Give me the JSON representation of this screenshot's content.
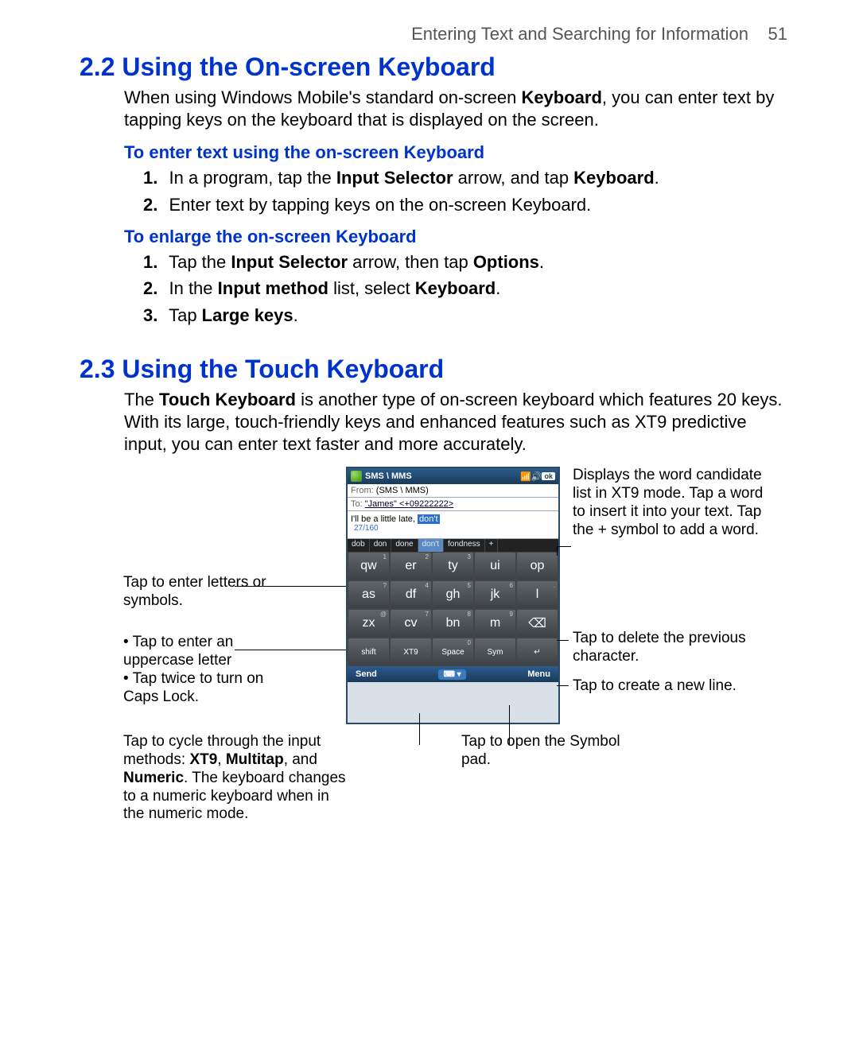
{
  "header": {
    "chapter_title": "Entering Text and Searching for Information",
    "page_number": "51"
  },
  "section22": {
    "heading": "2.2  Using the On-screen Keyboard",
    "intro_pre": "When using Windows Mobile's standard on-screen ",
    "intro_bold": "Keyboard",
    "intro_post": ", you can enter text by tapping keys on the keyboard that is displayed on the screen.",
    "sub1": "To enter text using the on-screen Keyboard",
    "s1_1_num": "1.",
    "s1_1_a": "In a program, tap the ",
    "s1_1_b": "Input Selector",
    "s1_1_c": " arrow, and tap ",
    "s1_1_d": "Keyboard",
    "s1_1_e": ".",
    "s1_2_num": "2.",
    "s1_2": "Enter text by tapping keys on the on-screen Keyboard.",
    "sub2": "To enlarge the on-screen Keyboard",
    "s2_1_num": "1.",
    "s2_1_a": "Tap the ",
    "s2_1_b": "Input Selector",
    "s2_1_c": " arrow, then tap ",
    "s2_1_d": "Options",
    "s2_1_e": ".",
    "s2_2_num": "2.",
    "s2_2_a": "In the ",
    "s2_2_b": "Input method",
    "s2_2_c": " list, select ",
    "s2_2_d": "Keyboard",
    "s2_2_e": ".",
    "s2_3_num": "3.",
    "s2_3_a": "Tap ",
    "s2_3_b": "Large keys",
    "s2_3_c": "."
  },
  "section23": {
    "heading": "2.3  Using the Touch Keyboard",
    "intro_a": "The ",
    "intro_b": "Touch Keyboard",
    "intro_c": " is another type of on-screen keyboard which features 20 keys. With its large, touch-friendly keys and enhanced features such as XT9 predictive input, you can enter text faster and more accurately."
  },
  "callouts": {
    "letters": "Tap to enter letters or symbols.",
    "upper1": "Tap to enter an uppercase letter",
    "upper2": "Tap twice to turn on Caps Lock.",
    "cycle_a": "Tap to cycle through the input methods: ",
    "cycle_b1": "XT9",
    "cycle_sep1": ", ",
    "cycle_b2": "Multitap",
    "cycle_sep2": ", and ",
    "cycle_b3": "Numeric",
    "cycle_c": ". The keyboard changes to a numeric keyboard when in the numeric mode.",
    "candidate": "Displays the word candidate list in XT9 mode. Tap a word to insert it into your text. Tap the + symbol to add a word.",
    "delete": "Tap to delete the previous character.",
    "newline": "Tap to create a new line.",
    "symbol": "Tap to open the Symbol pad."
  },
  "phone": {
    "title": "SMS \\ MMS",
    "ok": "ok",
    "from_label": "From:",
    "from_value": "(SMS \\ MMS)",
    "to_label": "To:",
    "to_value": "\"James\" <+09222222>",
    "body_text": "I'll be a little late, ",
    "body_pred": "don't",
    "char_count": "27/160",
    "candidates": [
      "dob",
      "don",
      "done",
      "don't",
      "fondness",
      "+"
    ],
    "row1": [
      {
        "main": "qw",
        "sup": "1"
      },
      {
        "main": "er",
        "sup": "2"
      },
      {
        "main": "ty",
        "sup": "3"
      },
      {
        "main": "ui",
        "sup": ""
      },
      {
        "main": "op",
        "sup": ""
      }
    ],
    "row2": [
      {
        "main": "as",
        "sup": "?"
      },
      {
        "main": "df",
        "sup": "4"
      },
      {
        "main": "gh",
        "sup": "5"
      },
      {
        "main": "jk",
        "sup": "6"
      },
      {
        "main": "l",
        "sup": "."
      }
    ],
    "row3": [
      {
        "main": "zx",
        "sup": "@"
      },
      {
        "main": "cv",
        "sup": "7"
      },
      {
        "main": "bn",
        "sup": "8"
      },
      {
        "main": "m",
        "sup": "9"
      },
      {
        "main": "⌫",
        "sup": ""
      }
    ],
    "row4": [
      {
        "main": "shift",
        "sup": ""
      },
      {
        "main": "XT9",
        "sup": ""
      },
      {
        "main": "Space",
        "sup": "0"
      },
      {
        "main": "Sym",
        "sup": ""
      },
      {
        "main": "↵",
        "sup": ""
      }
    ],
    "soft_left": "Send",
    "soft_mid": "⌨ ▾",
    "soft_right": "Menu"
  }
}
